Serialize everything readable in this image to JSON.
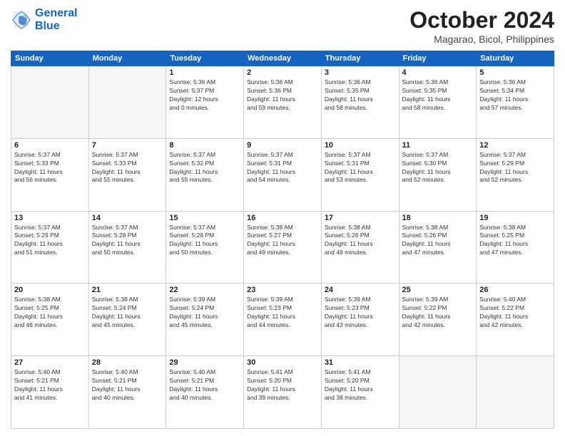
{
  "header": {
    "logo_line1": "General",
    "logo_line2": "Blue",
    "month_title": "October 2024",
    "subtitle": "Magarao, Bicol, Philippines"
  },
  "days_of_week": [
    "Sunday",
    "Monday",
    "Tuesday",
    "Wednesday",
    "Thursday",
    "Friday",
    "Saturday"
  ],
  "weeks": [
    [
      {
        "day": "",
        "info": ""
      },
      {
        "day": "",
        "info": ""
      },
      {
        "day": "1",
        "info": "Sunrise: 5:36 AM\nSunset: 5:37 PM\nDaylight: 12 hours\nand 0 minutes."
      },
      {
        "day": "2",
        "info": "Sunrise: 5:36 AM\nSunset: 5:36 PM\nDaylight: 11 hours\nand 59 minutes."
      },
      {
        "day": "3",
        "info": "Sunrise: 5:36 AM\nSunset: 5:35 PM\nDaylight: 11 hours\nand 58 minutes."
      },
      {
        "day": "4",
        "info": "Sunrise: 5:36 AM\nSunset: 5:35 PM\nDaylight: 11 hours\nand 58 minutes."
      },
      {
        "day": "5",
        "info": "Sunrise: 5:36 AM\nSunset: 5:34 PM\nDaylight: 11 hours\nand 57 minutes."
      }
    ],
    [
      {
        "day": "6",
        "info": "Sunrise: 5:37 AM\nSunset: 5:33 PM\nDaylight: 11 hours\nand 56 minutes."
      },
      {
        "day": "7",
        "info": "Sunrise: 5:37 AM\nSunset: 5:33 PM\nDaylight: 11 hours\nand 55 minutes."
      },
      {
        "day": "8",
        "info": "Sunrise: 5:37 AM\nSunset: 5:32 PM\nDaylight: 11 hours\nand 55 minutes."
      },
      {
        "day": "9",
        "info": "Sunrise: 5:37 AM\nSunset: 5:31 PM\nDaylight: 11 hours\nand 54 minutes."
      },
      {
        "day": "10",
        "info": "Sunrise: 5:37 AM\nSunset: 5:31 PM\nDaylight: 11 hours\nand 53 minutes."
      },
      {
        "day": "11",
        "info": "Sunrise: 5:37 AM\nSunset: 5:30 PM\nDaylight: 11 hours\nand 52 minutes."
      },
      {
        "day": "12",
        "info": "Sunrise: 5:37 AM\nSunset: 5:29 PM\nDaylight: 11 hours\nand 52 minutes."
      }
    ],
    [
      {
        "day": "13",
        "info": "Sunrise: 5:37 AM\nSunset: 5:29 PM\nDaylight: 11 hours\nand 51 minutes."
      },
      {
        "day": "14",
        "info": "Sunrise: 5:37 AM\nSunset: 5:28 PM\nDaylight: 11 hours\nand 50 minutes."
      },
      {
        "day": "15",
        "info": "Sunrise: 5:37 AM\nSunset: 5:28 PM\nDaylight: 11 hours\nand 50 minutes."
      },
      {
        "day": "16",
        "info": "Sunrise: 5:38 AM\nSunset: 5:27 PM\nDaylight: 11 hours\nand 49 minutes."
      },
      {
        "day": "17",
        "info": "Sunrise: 5:38 AM\nSunset: 5:26 PM\nDaylight: 11 hours\nand 48 minutes."
      },
      {
        "day": "18",
        "info": "Sunrise: 5:38 AM\nSunset: 5:26 PM\nDaylight: 11 hours\nand 47 minutes."
      },
      {
        "day": "19",
        "info": "Sunrise: 5:38 AM\nSunset: 5:25 PM\nDaylight: 11 hours\nand 47 minutes."
      }
    ],
    [
      {
        "day": "20",
        "info": "Sunrise: 5:38 AM\nSunset: 5:25 PM\nDaylight: 11 hours\nand 46 minutes."
      },
      {
        "day": "21",
        "info": "Sunrise: 5:38 AM\nSunset: 5:24 PM\nDaylight: 11 hours\nand 45 minutes."
      },
      {
        "day": "22",
        "info": "Sunrise: 5:39 AM\nSunset: 5:24 PM\nDaylight: 11 hours\nand 45 minutes."
      },
      {
        "day": "23",
        "info": "Sunrise: 5:39 AM\nSunset: 5:23 PM\nDaylight: 11 hours\nand 44 minutes."
      },
      {
        "day": "24",
        "info": "Sunrise: 5:39 AM\nSunset: 5:23 PM\nDaylight: 11 hours\nand 43 minutes."
      },
      {
        "day": "25",
        "info": "Sunrise: 5:39 AM\nSunset: 5:22 PM\nDaylight: 11 hours\nand 42 minutes."
      },
      {
        "day": "26",
        "info": "Sunrise: 5:40 AM\nSunset: 5:22 PM\nDaylight: 11 hours\nand 42 minutes."
      }
    ],
    [
      {
        "day": "27",
        "info": "Sunrise: 5:40 AM\nSunset: 5:21 PM\nDaylight: 11 hours\nand 41 minutes."
      },
      {
        "day": "28",
        "info": "Sunrise: 5:40 AM\nSunset: 5:21 PM\nDaylight: 11 hours\nand 40 minutes."
      },
      {
        "day": "29",
        "info": "Sunrise: 5:40 AM\nSunset: 5:21 PM\nDaylight: 11 hours\nand 40 minutes."
      },
      {
        "day": "30",
        "info": "Sunrise: 5:41 AM\nSunset: 5:20 PM\nDaylight: 11 hours\nand 39 minutes."
      },
      {
        "day": "31",
        "info": "Sunrise: 5:41 AM\nSunset: 5:20 PM\nDaylight: 11 hours\nand 38 minutes."
      },
      {
        "day": "",
        "info": ""
      },
      {
        "day": "",
        "info": ""
      }
    ]
  ]
}
